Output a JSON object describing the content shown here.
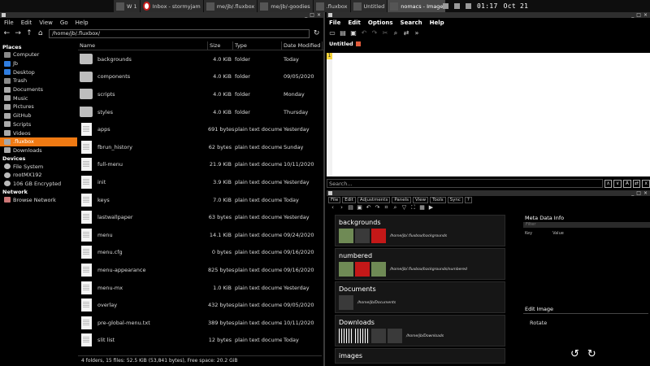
{
  "taskbar": {
    "tasks": [
      {
        "label": "W 1",
        "icon": "workspace-icon"
      },
      {
        "label": "Inbox - stormyjam",
        "icon": "opera-icon"
      },
      {
        "label": "me/jb/.fluxbox",
        "icon": "file-manager-icon"
      },
      {
        "label": "me/jb/-goodies",
        "icon": "file-manager-icon"
      },
      {
        "label": ".fluxbox",
        "icon": "file-manager-icon"
      },
      {
        "label": "Untitled",
        "icon": "editor-icon"
      },
      {
        "label": "nomacs - Image",
        "icon": "image-viewer-icon"
      }
    ],
    "clock": "01:17",
    "date": "Oct 21"
  },
  "file_manager": {
    "menu": [
      "File",
      "Edit",
      "View",
      "Go",
      "Help"
    ],
    "path": "/home/jb/.fluxbox/",
    "sidebar": {
      "places_heading": "Places",
      "places": [
        {
          "label": "Computer",
          "icon": "computer-icon"
        },
        {
          "label": "Jb",
          "icon": "home-icon"
        },
        {
          "label": "Desktop",
          "icon": "desktop-icon"
        },
        {
          "label": "Trash",
          "icon": "trash-icon"
        },
        {
          "label": "Documents",
          "icon": "folder-icon"
        },
        {
          "label": "Music",
          "icon": "folder-icon"
        },
        {
          "label": "Pictures",
          "icon": "folder-icon"
        },
        {
          "label": "GitHub",
          "icon": "folder-icon"
        },
        {
          "label": "Scripts",
          "icon": "folder-icon"
        },
        {
          "label": "Videos",
          "icon": "folder-icon"
        },
        {
          "label": ".fluxbox",
          "icon": "folder-icon",
          "active": true
        },
        {
          "label": "Downloads",
          "icon": "folder-icon"
        }
      ],
      "devices_heading": "Devices",
      "devices": [
        {
          "label": "File System",
          "icon": "disk-icon"
        },
        {
          "label": "rootMX192",
          "icon": "disk-icon"
        },
        {
          "label": "106 GB Encrypted",
          "icon": "disk-icon"
        }
      ],
      "network_heading": "Network",
      "network": [
        {
          "label": "Browse Network",
          "icon": "network-icon"
        }
      ]
    },
    "columns": [
      "Name",
      "Size",
      "Type",
      "Date Modified"
    ],
    "files": [
      {
        "name": "backgrounds",
        "size": "4.0 KiB",
        "type": "folder",
        "date": "Today",
        "kind": "folder"
      },
      {
        "name": "components",
        "size": "4.0 KiB",
        "type": "folder",
        "date": "09/05/2020",
        "kind": "folder"
      },
      {
        "name": "scripts",
        "size": "4.0 KiB",
        "type": "folder",
        "date": "Monday",
        "kind": "folder"
      },
      {
        "name": "styles",
        "size": "4.0 KiB",
        "type": "folder",
        "date": "Thursday",
        "kind": "folder"
      },
      {
        "name": "apps",
        "size": "691 bytes",
        "type": "plain text document",
        "date": "Yesterday",
        "kind": "doc"
      },
      {
        "name": "fbrun_history",
        "size": "62 bytes",
        "type": "plain text document",
        "date": "Sunday",
        "kind": "doc"
      },
      {
        "name": "full-menu",
        "size": "21.9 KiB",
        "type": "plain text document",
        "date": "10/11/2020",
        "kind": "doc"
      },
      {
        "name": "init",
        "size": "3.9 KiB",
        "type": "plain text document",
        "date": "Yesterday",
        "kind": "doc"
      },
      {
        "name": "keys",
        "size": "7.0 KiB",
        "type": "plain text document",
        "date": "Today",
        "kind": "doc"
      },
      {
        "name": "lastwallpaper",
        "size": "63 bytes",
        "type": "plain text document",
        "date": "Yesterday",
        "kind": "doc"
      },
      {
        "name": "menu",
        "size": "14.1 KiB",
        "type": "plain text document",
        "date": "09/24/2020",
        "kind": "doc"
      },
      {
        "name": "menu.cfg",
        "size": "0 bytes",
        "type": "plain text document",
        "date": "09/16/2020",
        "kind": "doc"
      },
      {
        "name": "menu-appearance",
        "size": "825 bytes",
        "type": "plain text document",
        "date": "09/16/2020",
        "kind": "doc"
      },
      {
        "name": "menu-mx",
        "size": "1.0 KiB",
        "type": "plain text document",
        "date": "Yesterday",
        "kind": "doc"
      },
      {
        "name": "overlay",
        "size": "432 bytes",
        "type": "plain text document",
        "date": "09/05/2020",
        "kind": "doc"
      },
      {
        "name": "pre-global-menu.txt",
        "size": "389 bytes",
        "type": "plain text document",
        "date": "10/11/2020",
        "kind": "doc"
      },
      {
        "name": "slit list",
        "size": "12 bytes",
        "type": "plain text document",
        "date": "Today",
        "kind": "doc"
      }
    ],
    "status": "4 folders, 15 files: 52.5 KiB (53,841 bytes), Free space: 20.2 GiB"
  },
  "editor": {
    "menu": [
      "File",
      "Edit",
      "Options",
      "Search",
      "Help"
    ],
    "tab_label": "Untitled",
    "line_number": "1",
    "search_placeholder": "Search...",
    "search_buttons": [
      "∧",
      "∨",
      "A",
      "⇄",
      "x"
    ]
  },
  "image_browser": {
    "menu": [
      "File",
      "Edit",
      "Adjustments",
      "Panels",
      "View",
      "Tools",
      "Sync",
      "?"
    ],
    "groups": [
      {
        "title": "backgrounds",
        "path": "/home/jb/.fluxbox/backgrounds",
        "thumbs": [
          "land",
          "dark",
          "red"
        ]
      },
      {
        "title": "numbered",
        "path": "/home/jb/.fluxbox/backgrounds/numbered",
        "thumbs": [
          "land",
          "red",
          "land"
        ]
      },
      {
        "title": "Documents",
        "path": "/home/jb/Documents",
        "thumbs": [
          "dark"
        ]
      },
      {
        "title": "Downloads",
        "path": "/home/jb/Downloads",
        "thumbs": [
          "bar",
          "bar",
          "dark",
          "dark"
        ]
      },
      {
        "title": "images",
        "path": "",
        "thumbs": []
      }
    ],
    "meta_heading": "Meta Data Info",
    "meta_file_label": "Filter",
    "meta_key": "Key",
    "meta_value": "Value",
    "edit_heading": "Edit Image",
    "rotate_label": "Rotate"
  }
}
